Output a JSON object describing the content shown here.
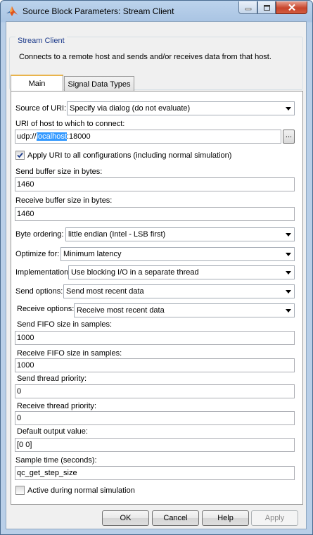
{
  "window": {
    "title": "Source Block Parameters: Stream Client"
  },
  "group": {
    "title": "Stream Client",
    "description": "Connects to a remote host and sends and/or receives data from that host."
  },
  "tabs": [
    {
      "label": "Main"
    },
    {
      "label": "Signal Data Types"
    }
  ],
  "params": {
    "source_label": "Source of URI:",
    "source_value": "Specify via dialog (do not evaluate)",
    "uri_label": "URI of host to which to connect:",
    "uri_prefix": "udp://",
    "uri_selected": "localhost",
    "uri_suffix": ":18000",
    "browse_label": "...",
    "apply_label": "Apply URI to all configurations (including normal simulation)",
    "send_buf_label": "Send buffer size in bytes:",
    "send_buf_value": "1460",
    "recv_buf_label": "Receive buffer size in bytes:",
    "recv_buf_value": "1460",
    "byte_label": "Byte ordering:",
    "byte_value": "little endian (Intel - LSB first)",
    "optimize_label": "Optimize for:",
    "optimize_value": "Minimum latency",
    "impl_label": "Implementation:",
    "impl_value": "Use blocking I/O in a separate thread",
    "send_opt_label": "Send options:",
    "send_opt_value": "Send most recent data",
    "recv_opt_label": "Receive options:",
    "recv_opt_value": "Receive most recent data",
    "send_fifo_label": "Send FIFO size in samples:",
    "send_fifo_value": "1000",
    "recv_fifo_label": "Receive FIFO size in samples:",
    "recv_fifo_value": "1000",
    "send_prio_label": "Send thread priority:",
    "send_prio_value": "0",
    "recv_prio_label": "Receive thread priority:",
    "recv_prio_value": "0",
    "default_label": "Default output value:",
    "default_value": "[0 0]",
    "sample_label": "Sample time (seconds):",
    "sample_value": "qc_get_step_size",
    "active_label": "Active during normal simulation"
  },
  "checks": {
    "apply_uri": true,
    "active_normal": false
  },
  "buttons": {
    "ok": "OK",
    "cancel": "Cancel",
    "help": "Help",
    "apply": "Apply"
  },
  "colors": {
    "group_title": "#1e3c8c",
    "selection": "#3399ff",
    "tab_accent": "#e9b44c",
    "close_button": "#c7452c"
  },
  "icons": {
    "app": "matlab-logo-icon",
    "minimize": "minimize-icon",
    "maximize": "maximize-icon",
    "close": "close-icon"
  }
}
